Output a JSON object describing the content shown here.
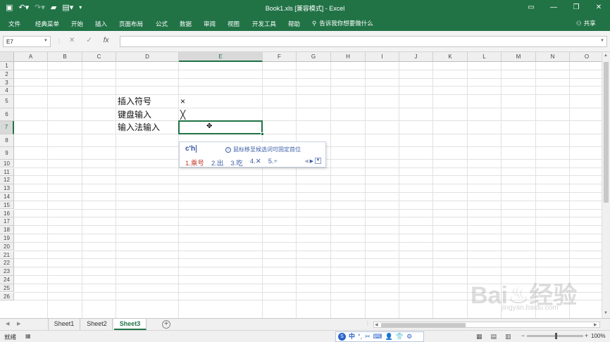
{
  "window": {
    "title": "Book1.xls  [兼容模式]  -  Excel",
    "qat": [
      "save-icon",
      "undo-icon",
      "redo-icon",
      "open-icon",
      "print-preview-icon",
      "customize-icon"
    ],
    "controls": [
      "ribbon-display-icon",
      "minimize-icon",
      "restore-icon",
      "close-icon"
    ]
  },
  "ribbon": {
    "tabs": [
      "文件",
      "经典菜单",
      "开始",
      "插入",
      "页面布局",
      "公式",
      "数据",
      "审阅",
      "视图",
      "开发工具",
      "帮助"
    ],
    "tell_me": "告诉我你想要做什么",
    "share": "共享"
  },
  "formula_bar": {
    "name_box": "E7",
    "cancel": "✕",
    "enter": "✓",
    "fx": "fx",
    "content": ""
  },
  "grid": {
    "columns": [
      "A",
      "B",
      "C",
      "D",
      "E",
      "F",
      "G",
      "H",
      "I",
      "J",
      "K",
      "L",
      "M",
      "N",
      "O"
    ],
    "selected_column": "E",
    "rows": [
      "1",
      "2",
      "3",
      "4",
      "5",
      "6",
      "7",
      "8",
      "9",
      "10",
      "11",
      "12",
      "13",
      "14",
      "15",
      "16",
      "17",
      "18",
      "19",
      "20",
      "21",
      "22",
      "23",
      "24",
      "25",
      "26"
    ],
    "selected_row": "7",
    "cells": {
      "D5": "插入符号",
      "E5": "×",
      "D6": "键盘输入",
      "E6": "╳",
      "D7": "输入法输入"
    }
  },
  "ime": {
    "input": "c'h",
    "tip": "鼠标移至候选词可固定首位",
    "candidates": [
      "1.乘号",
      "2.出",
      "3.吃",
      "4.✕",
      "5.÷"
    ]
  },
  "sheets": {
    "tabs": [
      "Sheet1",
      "Sheet2",
      "Sheet3"
    ],
    "active": "Sheet3",
    "add": "+"
  },
  "status": {
    "ready": "就绪",
    "zoom": "100%",
    "ime_bar": [
      "中",
      "°,",
      "✂",
      "⌨",
      "👤",
      "👕",
      "⚙"
    ]
  },
  "watermark": {
    "main": "Bai♨经验",
    "sub": "jingyan.baidu.com"
  }
}
